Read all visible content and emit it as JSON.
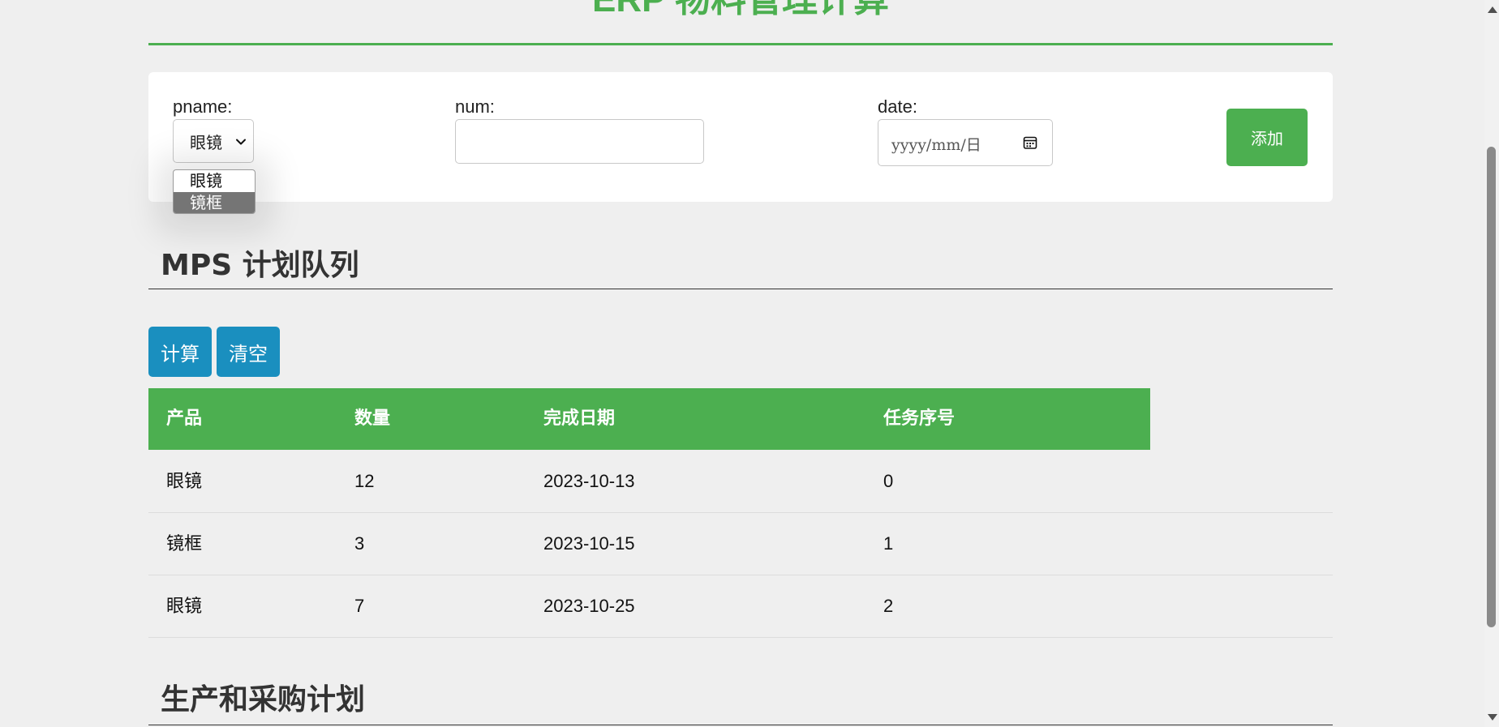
{
  "header": {
    "title": "ERP 物料管理计算"
  },
  "form": {
    "pname_label": "pname:",
    "pname_value": "眼镜",
    "pname_options": [
      "眼镜",
      "镜框"
    ],
    "num_label": "num:",
    "num_value": "",
    "date_label": "date:",
    "date_placeholder": "yyyy/mm/日",
    "add_label": "添加"
  },
  "mps": {
    "title": "MPS 计划队列",
    "calc_label": "计算",
    "clear_label": "清空",
    "columns": [
      "产品",
      "数量",
      "完成日期",
      "任务序号"
    ],
    "rows": [
      [
        "眼镜",
        "12",
        "2023-10-13",
        "0"
      ],
      [
        "镜框",
        "3",
        "2023-10-15",
        "1"
      ],
      [
        "眼镜",
        "7",
        "2023-10-25",
        "2"
      ]
    ]
  },
  "plan": {
    "title": "生产和采购计划"
  },
  "colors": {
    "accent_green": "#4caf50",
    "button_blue": "#1a8fbf",
    "background": "#efefef"
  }
}
